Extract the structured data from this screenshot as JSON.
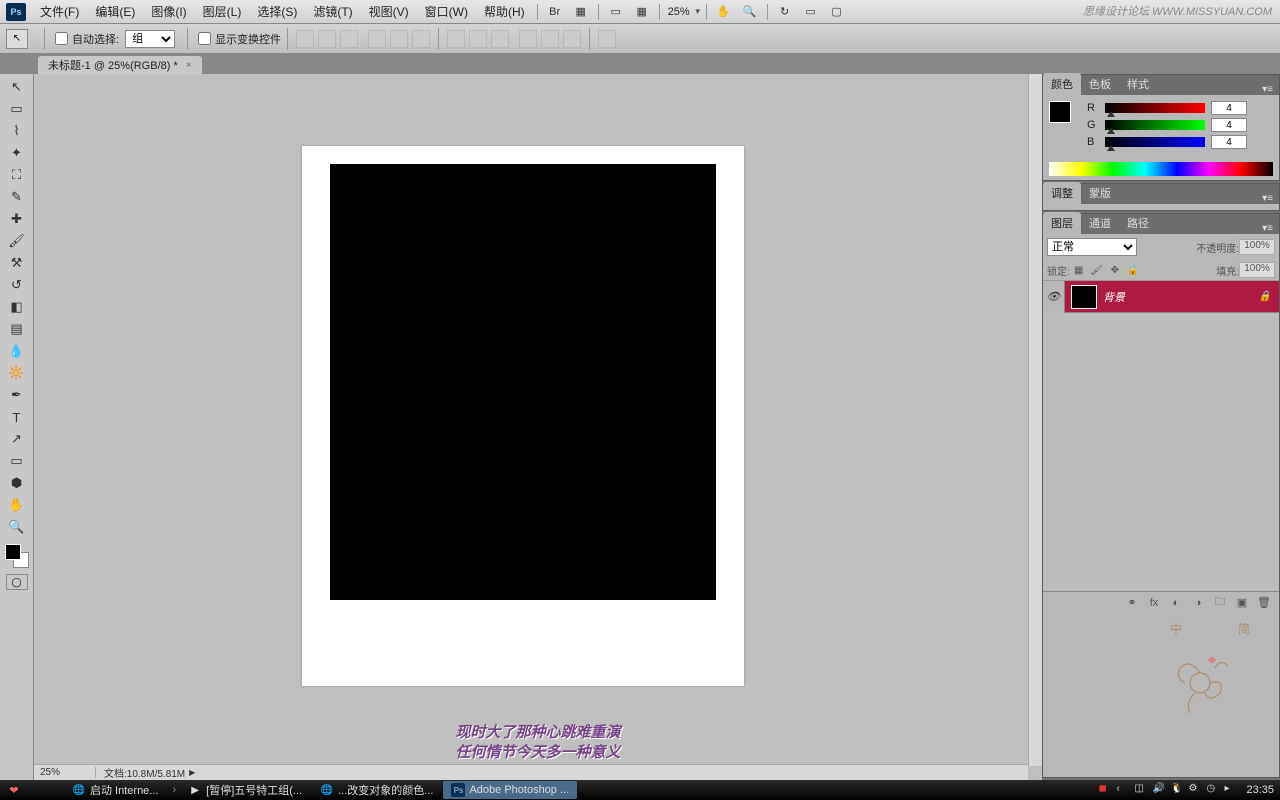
{
  "menubar": {
    "items": [
      "文件(F)",
      "编辑(E)",
      "图像(I)",
      "图层(L)",
      "选择(S)",
      "滤镜(T)",
      "视图(V)",
      "窗口(W)",
      "帮助(H)"
    ],
    "zoom": "25%",
    "watermark": "思缘设计论坛  WWW.MISSYUAN.COM"
  },
  "optbar": {
    "auto_select_label": "自动选择:",
    "auto_select_value": "组",
    "show_transform_label": "显示变换控件"
  },
  "doc_tab": {
    "title": "未标题-1 @ 25%(RGB/8) *"
  },
  "color_panel": {
    "tabs": [
      "颜色",
      "色板",
      "样式"
    ],
    "r": "4",
    "g": "4",
    "b": "4"
  },
  "adjust_panel": {
    "tabs": [
      "调整",
      "蒙版"
    ]
  },
  "layers_panel": {
    "tabs": [
      "图层",
      "通道",
      "路径"
    ],
    "blend_mode": "正常",
    "opacity_label": "不透明度:",
    "opacity_value": "100%",
    "lock_label": "锁定:",
    "fill_label": "填充:",
    "fill_value": "100%",
    "layers": [
      {
        "name": "背景",
        "locked": true
      }
    ]
  },
  "statusbar": {
    "zoom": "25%",
    "doc": "文档:10.8M/5.81M"
  },
  "subtitle": {
    "line1": "现时大了那种心跳难重演",
    "line2": "任何情节今天多一种意义"
  },
  "corner": {
    "t1": "中",
    "t2": "简"
  },
  "taskbar": {
    "items": [
      {
        "label": "启动 Interne...",
        "icon": "🌐",
        "active": false
      },
      {
        "label": "[暂停]五号特工组(...",
        "icon": "▶",
        "active": false
      },
      {
        "label": "...改变对象的颜色...",
        "icon": "🌐",
        "active": false
      },
      {
        "label": "Adobe Photoshop ...",
        "icon": "Ps",
        "active": true
      }
    ],
    "clock": "23:35"
  }
}
